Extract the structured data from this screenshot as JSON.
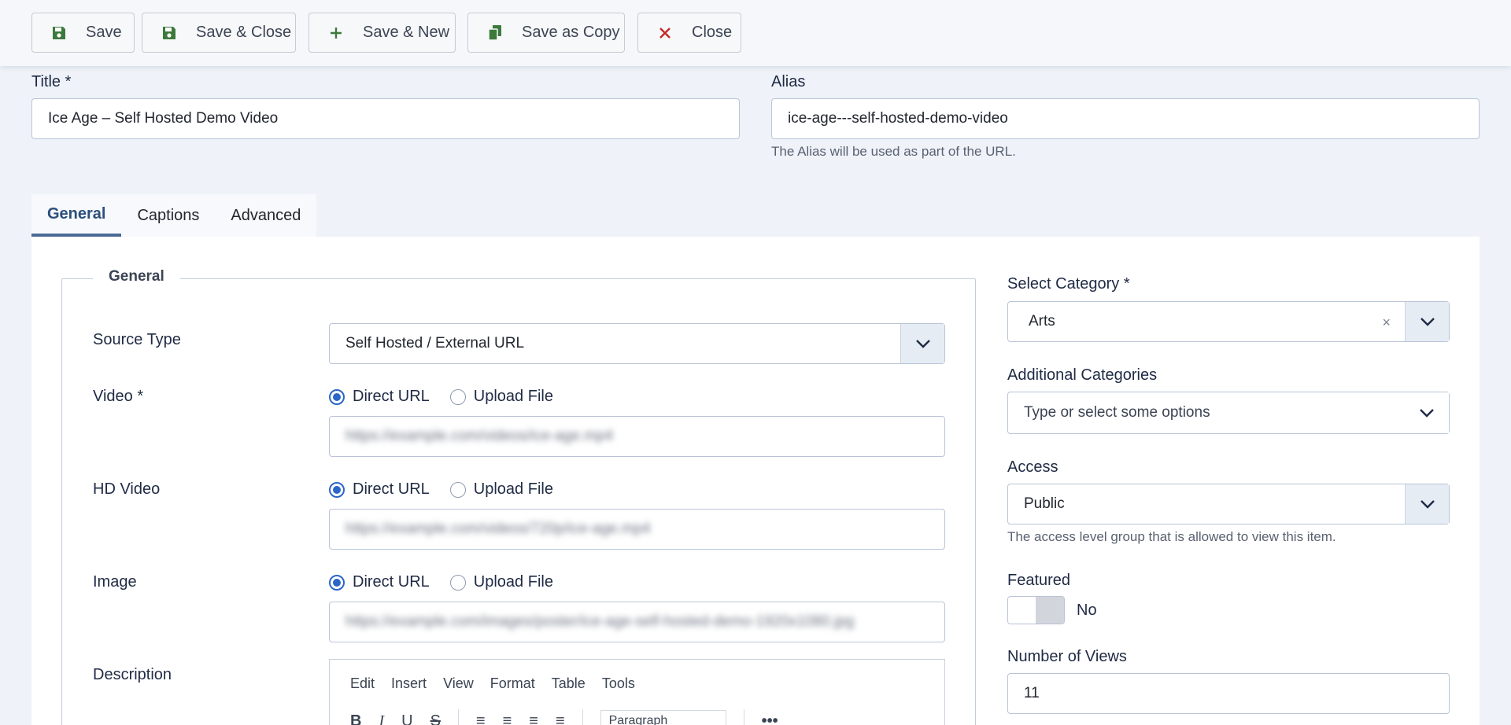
{
  "toolbar": {
    "save": "Save",
    "save_close": "Save & Close",
    "save_new": "Save & New",
    "save_copy": "Save as Copy",
    "close": "Close"
  },
  "title": {
    "label": "Title *",
    "value": "Ice Age – Self Hosted Demo Video"
  },
  "alias": {
    "label": "Alias",
    "value": "ice-age---self-hosted-demo-video",
    "hint": "The Alias will be used as part of the URL."
  },
  "tabs": [
    {
      "label": "General",
      "active": true
    },
    {
      "label": "Captions",
      "active": false
    },
    {
      "label": "Advanced",
      "active": false
    }
  ],
  "general": {
    "legend": "General",
    "source_type": {
      "label": "Source Type",
      "value": "Self Hosted / External URL"
    },
    "video": {
      "label": "Video *",
      "opt_direct": "Direct URL",
      "opt_upload": "Upload File",
      "selected": "Direct URL",
      "value": "https://example.com/videos/ice-age.mp4"
    },
    "hd_video": {
      "label": "HD Video",
      "opt_direct": "Direct URL",
      "opt_upload": "Upload File",
      "selected": "Direct URL",
      "value": "https://example.com/videos/720p/ice-age.mp4"
    },
    "image": {
      "label": "Image",
      "opt_direct": "Direct URL",
      "opt_upload": "Upload File",
      "selected": "Direct URL",
      "value": "https://example.com/images/poster/ice-age-self-hosted-demo-1920x1080.jpg"
    },
    "description": {
      "label": "Description",
      "menu": [
        "Edit",
        "Insert",
        "View",
        "Format",
        "Table",
        "Tools"
      ],
      "format_value": "Paragraph"
    }
  },
  "sidebar": {
    "category": {
      "label": "Select Category *",
      "value": "Arts"
    },
    "additional": {
      "label": "Additional Categories",
      "placeholder": "Type or select some options"
    },
    "access": {
      "label": "Access",
      "value": "Public",
      "hint": "The access level group that is allowed to view this item."
    },
    "featured": {
      "label": "Featured",
      "value": "No"
    },
    "views": {
      "label": "Number of Views",
      "value": "11"
    }
  },
  "colors": {
    "accent": "#2b66c7",
    "tab_active": "#2a4f7c",
    "danger": "#c62828",
    "save_icon": "#3c7a3c"
  }
}
